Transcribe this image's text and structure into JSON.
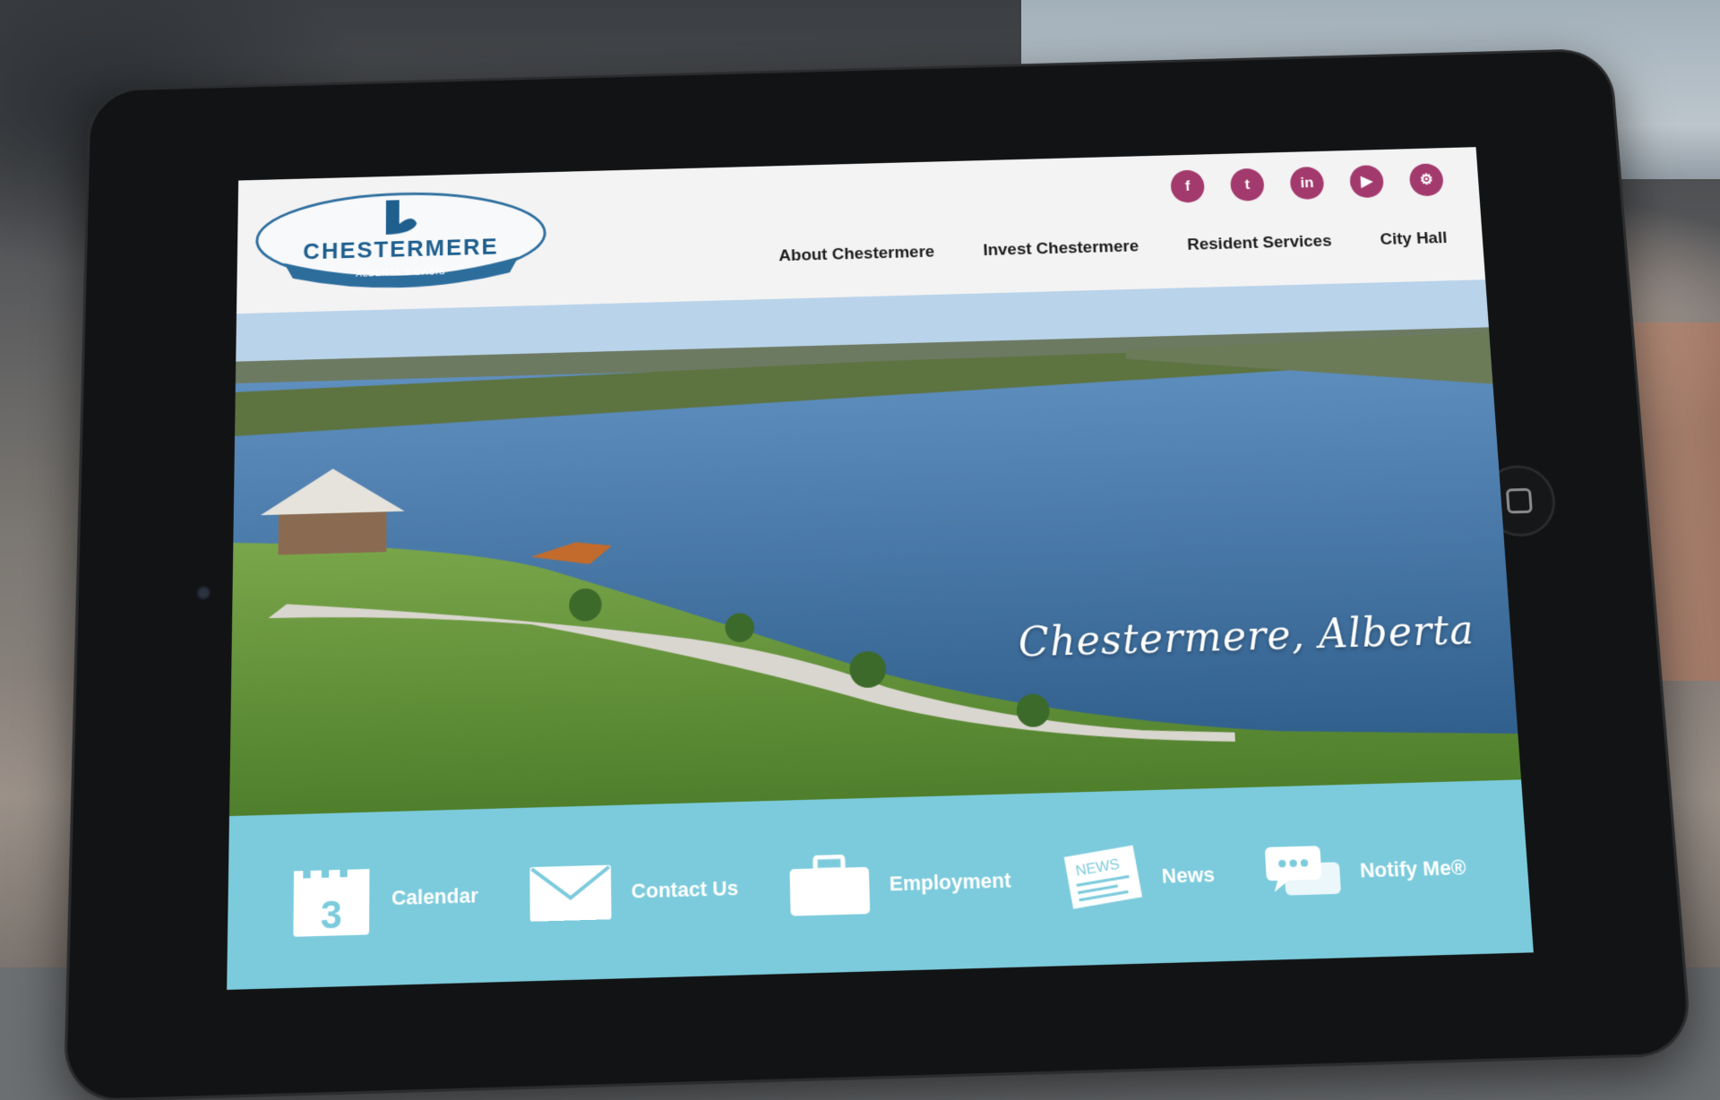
{
  "site": {
    "logo_name": "CHESTERMERE",
    "logo_tagline": "ALBERTA'S OASIS"
  },
  "social": [
    {
      "icon": "facebook-icon",
      "glyph": "f"
    },
    {
      "icon": "twitter-icon",
      "glyph": "t"
    },
    {
      "icon": "linkedin-icon",
      "glyph": "in"
    },
    {
      "icon": "youtube-icon",
      "glyph": "▶"
    },
    {
      "icon": "settings-icon",
      "glyph": "⚙"
    }
  ],
  "nav": [
    "About Chestermere",
    "Invest Chestermere",
    "Resident Services",
    "City Hall"
  ],
  "hero": {
    "tagline": "Chestermere, Alberta"
  },
  "quicklinks": {
    "calendar": {
      "label": "Calendar",
      "day": "3"
    },
    "contact": {
      "label": "Contact Us"
    },
    "employment": {
      "label": "Employment"
    },
    "news": {
      "label": "News",
      "badge": "NEWS"
    },
    "notify": {
      "label": "Notify Me®"
    }
  },
  "colors": {
    "brand_magenta": "#a33a6d",
    "quickbar": "#7ccbdc",
    "logo_blue": "#1f5f8e"
  }
}
